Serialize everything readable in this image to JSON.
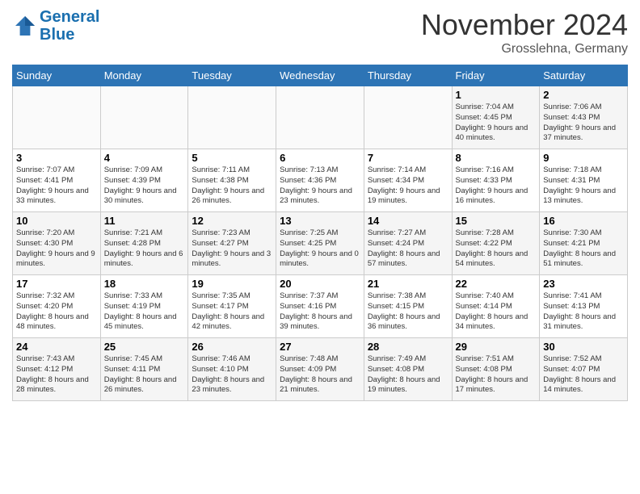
{
  "header": {
    "logo_line1": "General",
    "logo_line2": "Blue",
    "month_title": "November 2024",
    "location": "Grosslehna, Germany"
  },
  "weekdays": [
    "Sunday",
    "Monday",
    "Tuesday",
    "Wednesday",
    "Thursday",
    "Friday",
    "Saturday"
  ],
  "weeks": [
    [
      {
        "day": "",
        "empty": true
      },
      {
        "day": "",
        "empty": true
      },
      {
        "day": "",
        "empty": true
      },
      {
        "day": "",
        "empty": true
      },
      {
        "day": "",
        "empty": true
      },
      {
        "day": "1",
        "sunrise": "Sunrise: 7:04 AM",
        "sunset": "Sunset: 4:45 PM",
        "daylight": "Daylight: 9 hours and 40 minutes."
      },
      {
        "day": "2",
        "sunrise": "Sunrise: 7:06 AM",
        "sunset": "Sunset: 4:43 PM",
        "daylight": "Daylight: 9 hours and 37 minutes."
      }
    ],
    [
      {
        "day": "3",
        "sunrise": "Sunrise: 7:07 AM",
        "sunset": "Sunset: 4:41 PM",
        "daylight": "Daylight: 9 hours and 33 minutes."
      },
      {
        "day": "4",
        "sunrise": "Sunrise: 7:09 AM",
        "sunset": "Sunset: 4:39 PM",
        "daylight": "Daylight: 9 hours and 30 minutes."
      },
      {
        "day": "5",
        "sunrise": "Sunrise: 7:11 AM",
        "sunset": "Sunset: 4:38 PM",
        "daylight": "Daylight: 9 hours and 26 minutes."
      },
      {
        "day": "6",
        "sunrise": "Sunrise: 7:13 AM",
        "sunset": "Sunset: 4:36 PM",
        "daylight": "Daylight: 9 hours and 23 minutes."
      },
      {
        "day": "7",
        "sunrise": "Sunrise: 7:14 AM",
        "sunset": "Sunset: 4:34 PM",
        "daylight": "Daylight: 9 hours and 19 minutes."
      },
      {
        "day": "8",
        "sunrise": "Sunrise: 7:16 AM",
        "sunset": "Sunset: 4:33 PM",
        "daylight": "Daylight: 9 hours and 16 minutes."
      },
      {
        "day": "9",
        "sunrise": "Sunrise: 7:18 AM",
        "sunset": "Sunset: 4:31 PM",
        "daylight": "Daylight: 9 hours and 13 minutes."
      }
    ],
    [
      {
        "day": "10",
        "sunrise": "Sunrise: 7:20 AM",
        "sunset": "Sunset: 4:30 PM",
        "daylight": "Daylight: 9 hours and 9 minutes."
      },
      {
        "day": "11",
        "sunrise": "Sunrise: 7:21 AM",
        "sunset": "Sunset: 4:28 PM",
        "daylight": "Daylight: 9 hours and 6 minutes."
      },
      {
        "day": "12",
        "sunrise": "Sunrise: 7:23 AM",
        "sunset": "Sunset: 4:27 PM",
        "daylight": "Daylight: 9 hours and 3 minutes."
      },
      {
        "day": "13",
        "sunrise": "Sunrise: 7:25 AM",
        "sunset": "Sunset: 4:25 PM",
        "daylight": "Daylight: 9 hours and 0 minutes."
      },
      {
        "day": "14",
        "sunrise": "Sunrise: 7:27 AM",
        "sunset": "Sunset: 4:24 PM",
        "daylight": "Daylight: 8 hours and 57 minutes."
      },
      {
        "day": "15",
        "sunrise": "Sunrise: 7:28 AM",
        "sunset": "Sunset: 4:22 PM",
        "daylight": "Daylight: 8 hours and 54 minutes."
      },
      {
        "day": "16",
        "sunrise": "Sunrise: 7:30 AM",
        "sunset": "Sunset: 4:21 PM",
        "daylight": "Daylight: 8 hours and 51 minutes."
      }
    ],
    [
      {
        "day": "17",
        "sunrise": "Sunrise: 7:32 AM",
        "sunset": "Sunset: 4:20 PM",
        "daylight": "Daylight: 8 hours and 48 minutes."
      },
      {
        "day": "18",
        "sunrise": "Sunrise: 7:33 AM",
        "sunset": "Sunset: 4:19 PM",
        "daylight": "Daylight: 8 hours and 45 minutes."
      },
      {
        "day": "19",
        "sunrise": "Sunrise: 7:35 AM",
        "sunset": "Sunset: 4:17 PM",
        "daylight": "Daylight: 8 hours and 42 minutes."
      },
      {
        "day": "20",
        "sunrise": "Sunrise: 7:37 AM",
        "sunset": "Sunset: 4:16 PM",
        "daylight": "Daylight: 8 hours and 39 minutes."
      },
      {
        "day": "21",
        "sunrise": "Sunrise: 7:38 AM",
        "sunset": "Sunset: 4:15 PM",
        "daylight": "Daylight: 8 hours and 36 minutes."
      },
      {
        "day": "22",
        "sunrise": "Sunrise: 7:40 AM",
        "sunset": "Sunset: 4:14 PM",
        "daylight": "Daylight: 8 hours and 34 minutes."
      },
      {
        "day": "23",
        "sunrise": "Sunrise: 7:41 AM",
        "sunset": "Sunset: 4:13 PM",
        "daylight": "Daylight: 8 hours and 31 minutes."
      }
    ],
    [
      {
        "day": "24",
        "sunrise": "Sunrise: 7:43 AM",
        "sunset": "Sunset: 4:12 PM",
        "daylight": "Daylight: 8 hours and 28 minutes."
      },
      {
        "day": "25",
        "sunrise": "Sunrise: 7:45 AM",
        "sunset": "Sunset: 4:11 PM",
        "daylight": "Daylight: 8 hours and 26 minutes."
      },
      {
        "day": "26",
        "sunrise": "Sunrise: 7:46 AM",
        "sunset": "Sunset: 4:10 PM",
        "daylight": "Daylight: 8 hours and 23 minutes."
      },
      {
        "day": "27",
        "sunrise": "Sunrise: 7:48 AM",
        "sunset": "Sunset: 4:09 PM",
        "daylight": "Daylight: 8 hours and 21 minutes."
      },
      {
        "day": "28",
        "sunrise": "Sunrise: 7:49 AM",
        "sunset": "Sunset: 4:08 PM",
        "daylight": "Daylight: 8 hours and 19 minutes."
      },
      {
        "day": "29",
        "sunrise": "Sunrise: 7:51 AM",
        "sunset": "Sunset: 4:08 PM",
        "daylight": "Daylight: 8 hours and 17 minutes."
      },
      {
        "day": "30",
        "sunrise": "Sunrise: 7:52 AM",
        "sunset": "Sunset: 4:07 PM",
        "daylight": "Daylight: 8 hours and 14 minutes."
      }
    ]
  ]
}
